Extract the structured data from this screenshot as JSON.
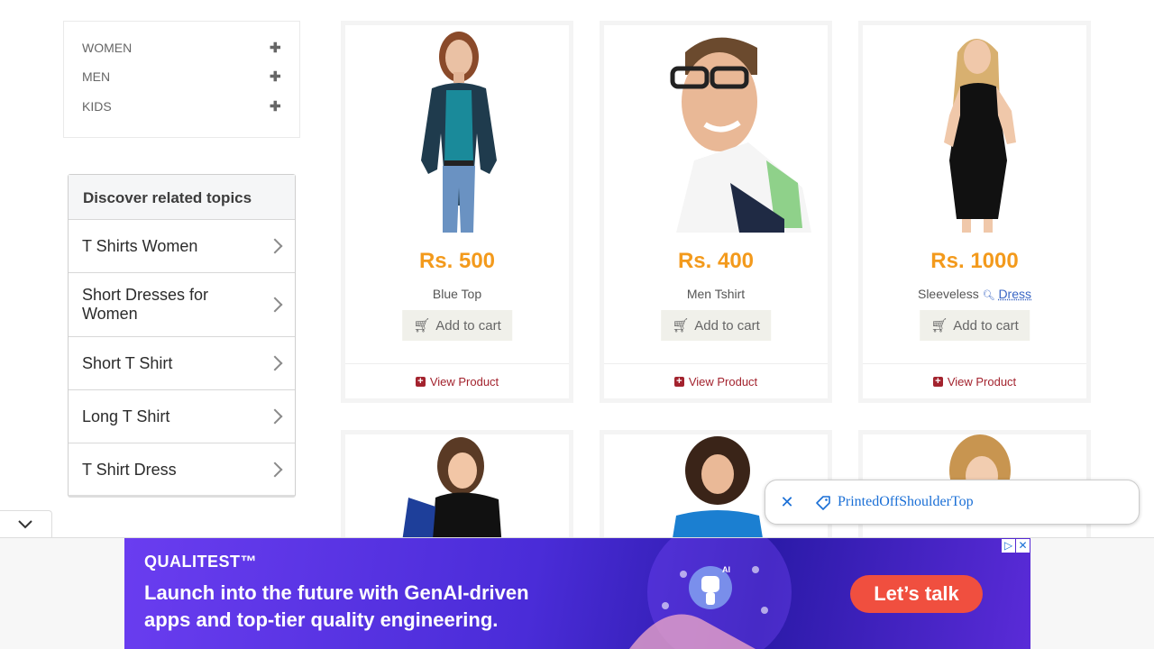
{
  "categories": [
    {
      "label": "WOMEN",
      "icon": "plus-icon"
    },
    {
      "label": "MEN",
      "icon": "plus-icon"
    },
    {
      "label": "KIDS",
      "icon": "plus-icon"
    }
  ],
  "related": {
    "title": "Discover related topics",
    "items": [
      "T Shirts Women",
      "Short Dresses for Women",
      "Short T Shirt",
      "Long T Shirt",
      "T Shirt Dress"
    ]
  },
  "products": [
    {
      "price": "Rs. 500",
      "name": "Blue Top",
      "cart": "Add to cart",
      "view": "View Product"
    },
    {
      "price": "Rs. 400",
      "name": "Men Tshirt",
      "cart": "Add to cart",
      "view": "View Product"
    },
    {
      "price": "Rs. 1000",
      "name_prefix": "Sleeveless",
      "name_link": "Dress",
      "cart": "Add to cart",
      "view": "View Product"
    }
  ],
  "chip": {
    "text": "PrintedOffShoulderTop"
  },
  "ad": {
    "brand": "QUALITEST™",
    "line1": "Launch into the future with GenAI-driven",
    "line2": "apps and top-tier quality engineering.",
    "cta": "Let’s talk",
    "robot_label": "AI"
  },
  "colors": {
    "price": "#f39a1c",
    "view_link": "#a3232e",
    "chip_text": "#1a6fd6",
    "ad_cta": "#f04f3f"
  }
}
